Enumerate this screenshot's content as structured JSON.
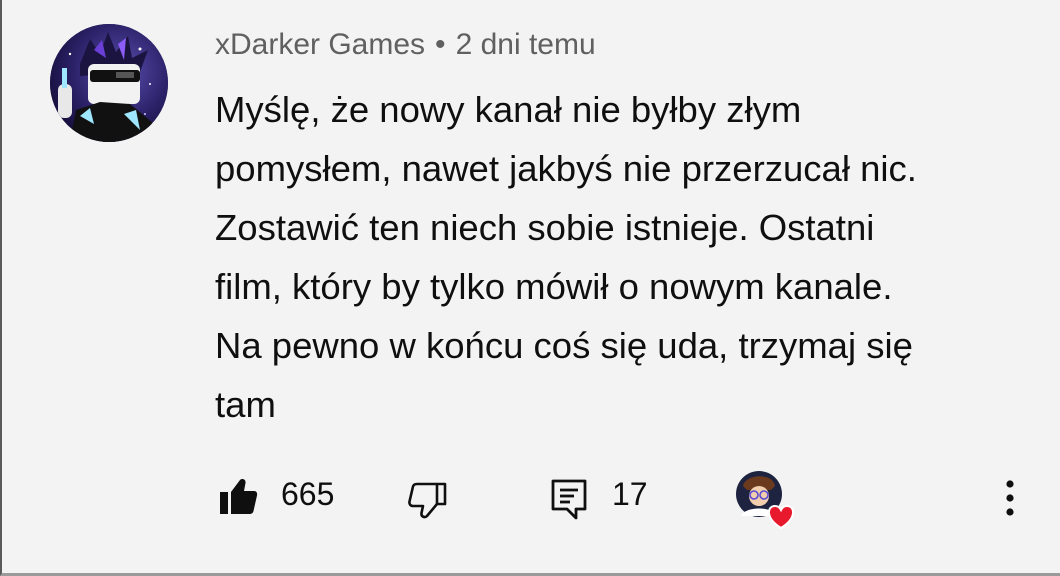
{
  "comment": {
    "author": "xDarker Games",
    "separator": "•",
    "timestamp": "2 dni temu",
    "lines": [
      "Myślę, że nowy kanał nie byłby złym",
      "pomysłem, nawet jakbyś nie przerzucał nic.",
      "Zostawić ten niech sobie istnieje. Ostatni",
      "film, który by tylko mówił o nowym kanale.",
      "Na pewno w końcu coś się uda, trzymaj się",
      "tam"
    ]
  },
  "actions": {
    "like_count": "665",
    "reply_count": "17"
  },
  "icons": {
    "like": "thumbs-up-filled-icon",
    "dislike": "thumbs-down-outline-icon",
    "reply": "comment-reply-icon",
    "creator_heart": "creator-heart-icon",
    "more": "more-vertical-icon"
  },
  "colors": {
    "background": "#f3f3f3",
    "text": "#0f0f0f",
    "meta_text": "#606060",
    "heart": "#e8192c"
  }
}
